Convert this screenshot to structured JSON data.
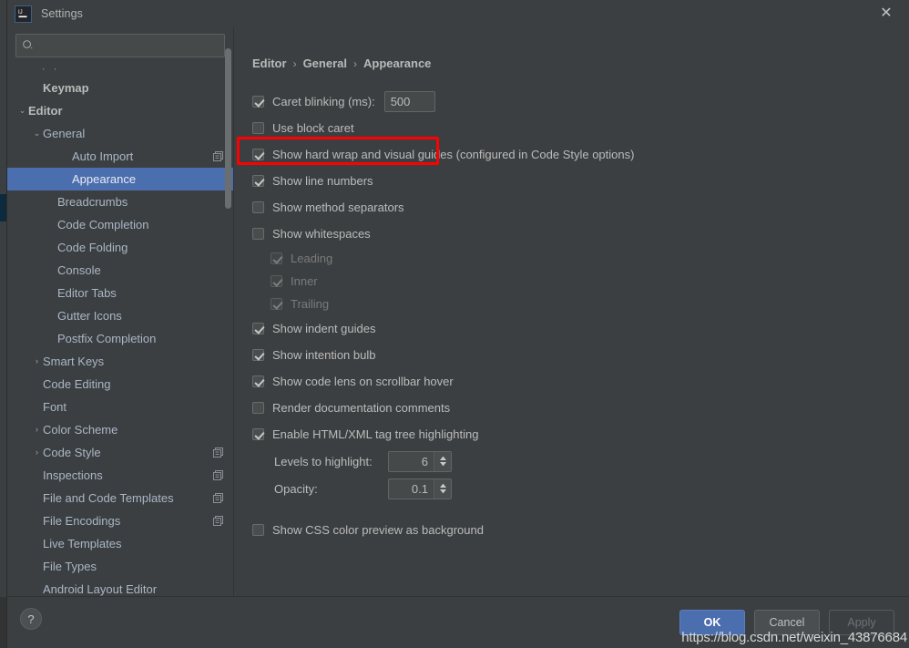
{
  "window": {
    "title": "Settings",
    "app_icon": "intellij-idea-icon",
    "close_label": "✕"
  },
  "search": {
    "value": "",
    "placeholder": "",
    "icon": "search-icon"
  },
  "sidebar": {
    "ellipsis": "· ·",
    "items": [
      {
        "label": "Keymap",
        "indent": 1,
        "arrow": "",
        "bold": true,
        "selected": false,
        "copy_icon": false
      },
      {
        "label": "Editor",
        "indent": 0,
        "arrow": "⌄",
        "bold": true,
        "selected": false,
        "copy_icon": false
      },
      {
        "label": "General",
        "indent": 1,
        "arrow": "⌄",
        "bold": false,
        "selected": false,
        "copy_icon": false
      },
      {
        "label": "Auto Import",
        "indent": 3,
        "arrow": "",
        "bold": false,
        "selected": false,
        "copy_icon": true
      },
      {
        "label": "Appearance",
        "indent": 3,
        "arrow": "",
        "bold": false,
        "selected": true,
        "copy_icon": false
      },
      {
        "label": "Breadcrumbs",
        "indent": 2,
        "arrow": "",
        "bold": false,
        "selected": false,
        "copy_icon": false
      },
      {
        "label": "Code Completion",
        "indent": 2,
        "arrow": "",
        "bold": false,
        "selected": false,
        "copy_icon": false
      },
      {
        "label": "Code Folding",
        "indent": 2,
        "arrow": "",
        "bold": false,
        "selected": false,
        "copy_icon": false
      },
      {
        "label": "Console",
        "indent": 2,
        "arrow": "",
        "bold": false,
        "selected": false,
        "copy_icon": false
      },
      {
        "label": "Editor Tabs",
        "indent": 2,
        "arrow": "",
        "bold": false,
        "selected": false,
        "copy_icon": false
      },
      {
        "label": "Gutter Icons",
        "indent": 2,
        "arrow": "",
        "bold": false,
        "selected": false,
        "copy_icon": false
      },
      {
        "label": "Postfix Completion",
        "indent": 2,
        "arrow": "",
        "bold": false,
        "selected": false,
        "copy_icon": false
      },
      {
        "label": "Smart Keys",
        "indent": 1,
        "arrow": "›",
        "bold": false,
        "selected": false,
        "copy_icon": false
      },
      {
        "label": "Code Editing",
        "indent": 1,
        "arrow": "",
        "bold": false,
        "selected": false,
        "copy_icon": false
      },
      {
        "label": "Font",
        "indent": 1,
        "arrow": "",
        "bold": false,
        "selected": false,
        "copy_icon": false
      },
      {
        "label": "Color Scheme",
        "indent": 1,
        "arrow": "›",
        "bold": false,
        "selected": false,
        "copy_icon": false
      },
      {
        "label": "Code Style",
        "indent": 1,
        "arrow": "›",
        "bold": false,
        "selected": false,
        "copy_icon": true
      },
      {
        "label": "Inspections",
        "indent": 1,
        "arrow": "",
        "bold": false,
        "selected": false,
        "copy_icon": true
      },
      {
        "label": "File and Code Templates",
        "indent": 1,
        "arrow": "",
        "bold": false,
        "selected": false,
        "copy_icon": true
      },
      {
        "label": "File Encodings",
        "indent": 1,
        "arrow": "",
        "bold": false,
        "selected": false,
        "copy_icon": true
      },
      {
        "label": "Live Templates",
        "indent": 1,
        "arrow": "",
        "bold": false,
        "selected": false,
        "copy_icon": false
      },
      {
        "label": "File Types",
        "indent": 1,
        "arrow": "",
        "bold": false,
        "selected": false,
        "copy_icon": false
      },
      {
        "label": "Android Layout Editor",
        "indent": 1,
        "arrow": "",
        "bold": false,
        "selected": false,
        "copy_icon": false
      }
    ]
  },
  "breadcrumb": {
    "separator": "›",
    "items": [
      "Editor",
      "General",
      "Appearance"
    ]
  },
  "options": [
    {
      "name": "caret-blinking",
      "label": "Caret blinking (ms):",
      "checked": true,
      "disabled": false,
      "indent": 0,
      "input": "500"
    },
    {
      "name": "use-block-caret",
      "label": "Use block caret",
      "checked": false,
      "disabled": false,
      "indent": 0
    },
    {
      "name": "show-hard-wrap",
      "label": "Show hard wrap and visual guides (configured in Code Style options)",
      "checked": true,
      "disabled": false,
      "indent": 0
    },
    {
      "name": "show-line-numbers",
      "label": "Show line numbers",
      "checked": true,
      "disabled": false,
      "indent": 0,
      "highlighted": true
    },
    {
      "name": "show-method-separators",
      "label": "Show method separators",
      "checked": false,
      "disabled": false,
      "indent": 0
    },
    {
      "name": "show-whitespaces",
      "label": "Show whitespaces",
      "checked": false,
      "disabled": false,
      "indent": 0
    },
    {
      "name": "whitespace-leading",
      "label": "Leading",
      "checked": true,
      "disabled": true,
      "indent": 1
    },
    {
      "name": "whitespace-inner",
      "label": "Inner",
      "checked": true,
      "disabled": true,
      "indent": 1
    },
    {
      "name": "whitespace-trailing",
      "label": "Trailing",
      "checked": true,
      "disabled": true,
      "indent": 1
    },
    {
      "name": "show-indent-guides",
      "label": "Show indent guides",
      "checked": true,
      "disabled": false,
      "indent": 0
    },
    {
      "name": "show-intention-bulb",
      "label": "Show intention bulb",
      "checked": true,
      "disabled": false,
      "indent": 0
    },
    {
      "name": "show-code-lens",
      "label": "Show code lens on scrollbar hover",
      "checked": true,
      "disabled": false,
      "indent": 0
    },
    {
      "name": "render-documentation-comments",
      "label": "Render documentation comments",
      "checked": false,
      "disabled": false,
      "indent": 0
    },
    {
      "name": "enable-html-xml-tag-tree-highlighting",
      "label": "Enable HTML/XML tag tree highlighting",
      "checked": true,
      "disabled": false,
      "indent": 0
    }
  ],
  "spinners": [
    {
      "name": "levels-to-highlight",
      "label": "Levels to highlight:",
      "value": "6"
    },
    {
      "name": "opacity",
      "label": "Opacity:",
      "value": "0.1"
    }
  ],
  "trailing_option": {
    "name": "show-css-color-preview",
    "label": "Show CSS color preview as background",
    "checked": false
  },
  "footer": {
    "help_label": "?",
    "ok_label": "OK",
    "cancel_label": "Cancel",
    "apply_label": "Apply"
  },
  "watermark": "https://blog.csdn.net/weixin_43876684",
  "colors": {
    "accent_selection": "#4b6eaf",
    "highlight_box": "#fd0000",
    "panel_bg": "#3c3f41",
    "text": "#bbbbbb",
    "tree_text": "#a9b7c6"
  }
}
